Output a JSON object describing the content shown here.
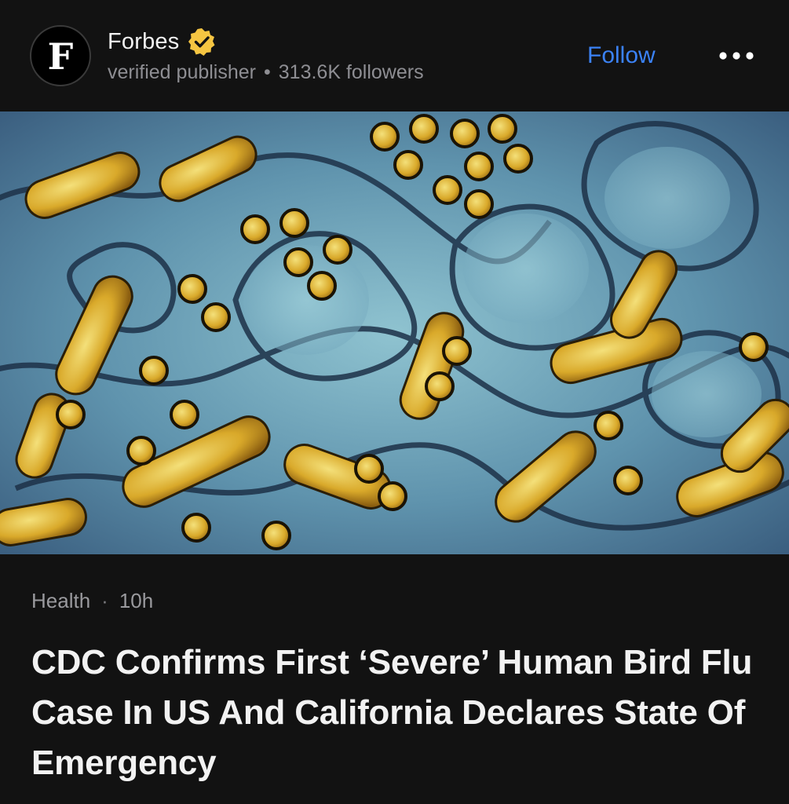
{
  "publisher": {
    "avatar_letter": "F",
    "name": "Forbes",
    "verified_icon": "verified-badge-icon",
    "verified_color": "#f5c542",
    "status": "verified publisher",
    "followers": "313.6K followers"
  },
  "actions": {
    "follow_label": "Follow",
    "follow_color": "#3b82f6",
    "more_icon": "more-horizontal-icon"
  },
  "article": {
    "category": "Health",
    "time_ago": "10h",
    "headline": "CDC Confirms First ‘Severe’ Human Bird Flu Case In US And California Declares State Of Emergency"
  }
}
